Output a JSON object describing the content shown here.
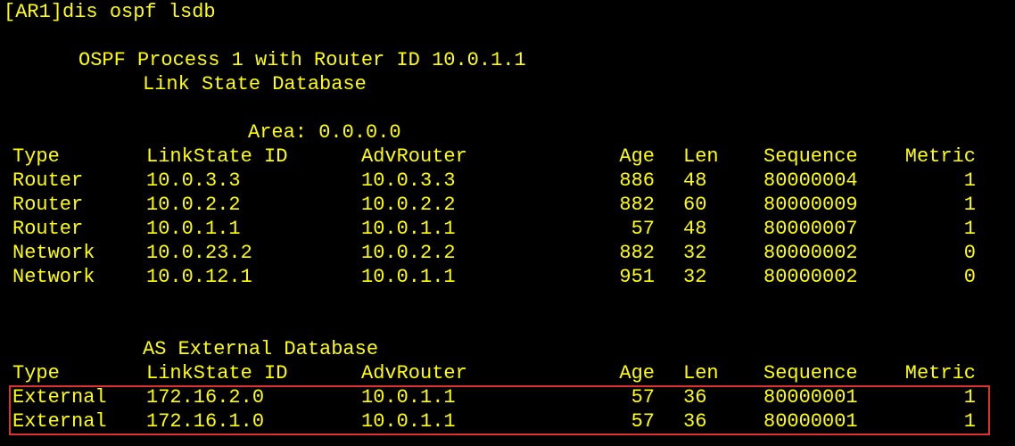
{
  "prompt": "[AR1]dis ospf lsdb",
  "process_title": "OSPF Process 1 with Router ID 10.0.1.1",
  "db_title": "Link State Database",
  "area_label": "Area: 0.0.0.0",
  "headers": [
    "Type",
    "LinkState ID",
    "AdvRouter",
    "Age",
    "Len",
    "Sequence",
    "Metric"
  ],
  "area_rows": [
    [
      "Router",
      "10.0.3.3",
      "10.0.3.3",
      "886",
      "48",
      "80000004",
      "1"
    ],
    [
      "Router",
      "10.0.2.2",
      "10.0.2.2",
      "882",
      "60",
      "80000009",
      "1"
    ],
    [
      "Router",
      "10.0.1.1",
      "10.0.1.1",
      "57",
      "48",
      "80000007",
      "1"
    ],
    [
      "Network",
      "10.0.23.2",
      "10.0.2.2",
      "882",
      "32",
      "80000002",
      "0"
    ],
    [
      "Network",
      "10.0.12.1",
      "10.0.1.1",
      "951",
      "32",
      "80000002",
      "0"
    ]
  ],
  "external_title": "AS External Database",
  "external_rows": [
    [
      "External",
      "172.16.2.0",
      "10.0.1.1",
      "57",
      "36",
      "80000001",
      "1"
    ],
    [
      "External",
      "172.16.1.0",
      "10.0.1.1",
      "57",
      "36",
      "80000001",
      "1"
    ]
  ],
  "colors": {
    "background": "#000000",
    "text": "#ffff00",
    "highlight": "#e03030"
  }
}
